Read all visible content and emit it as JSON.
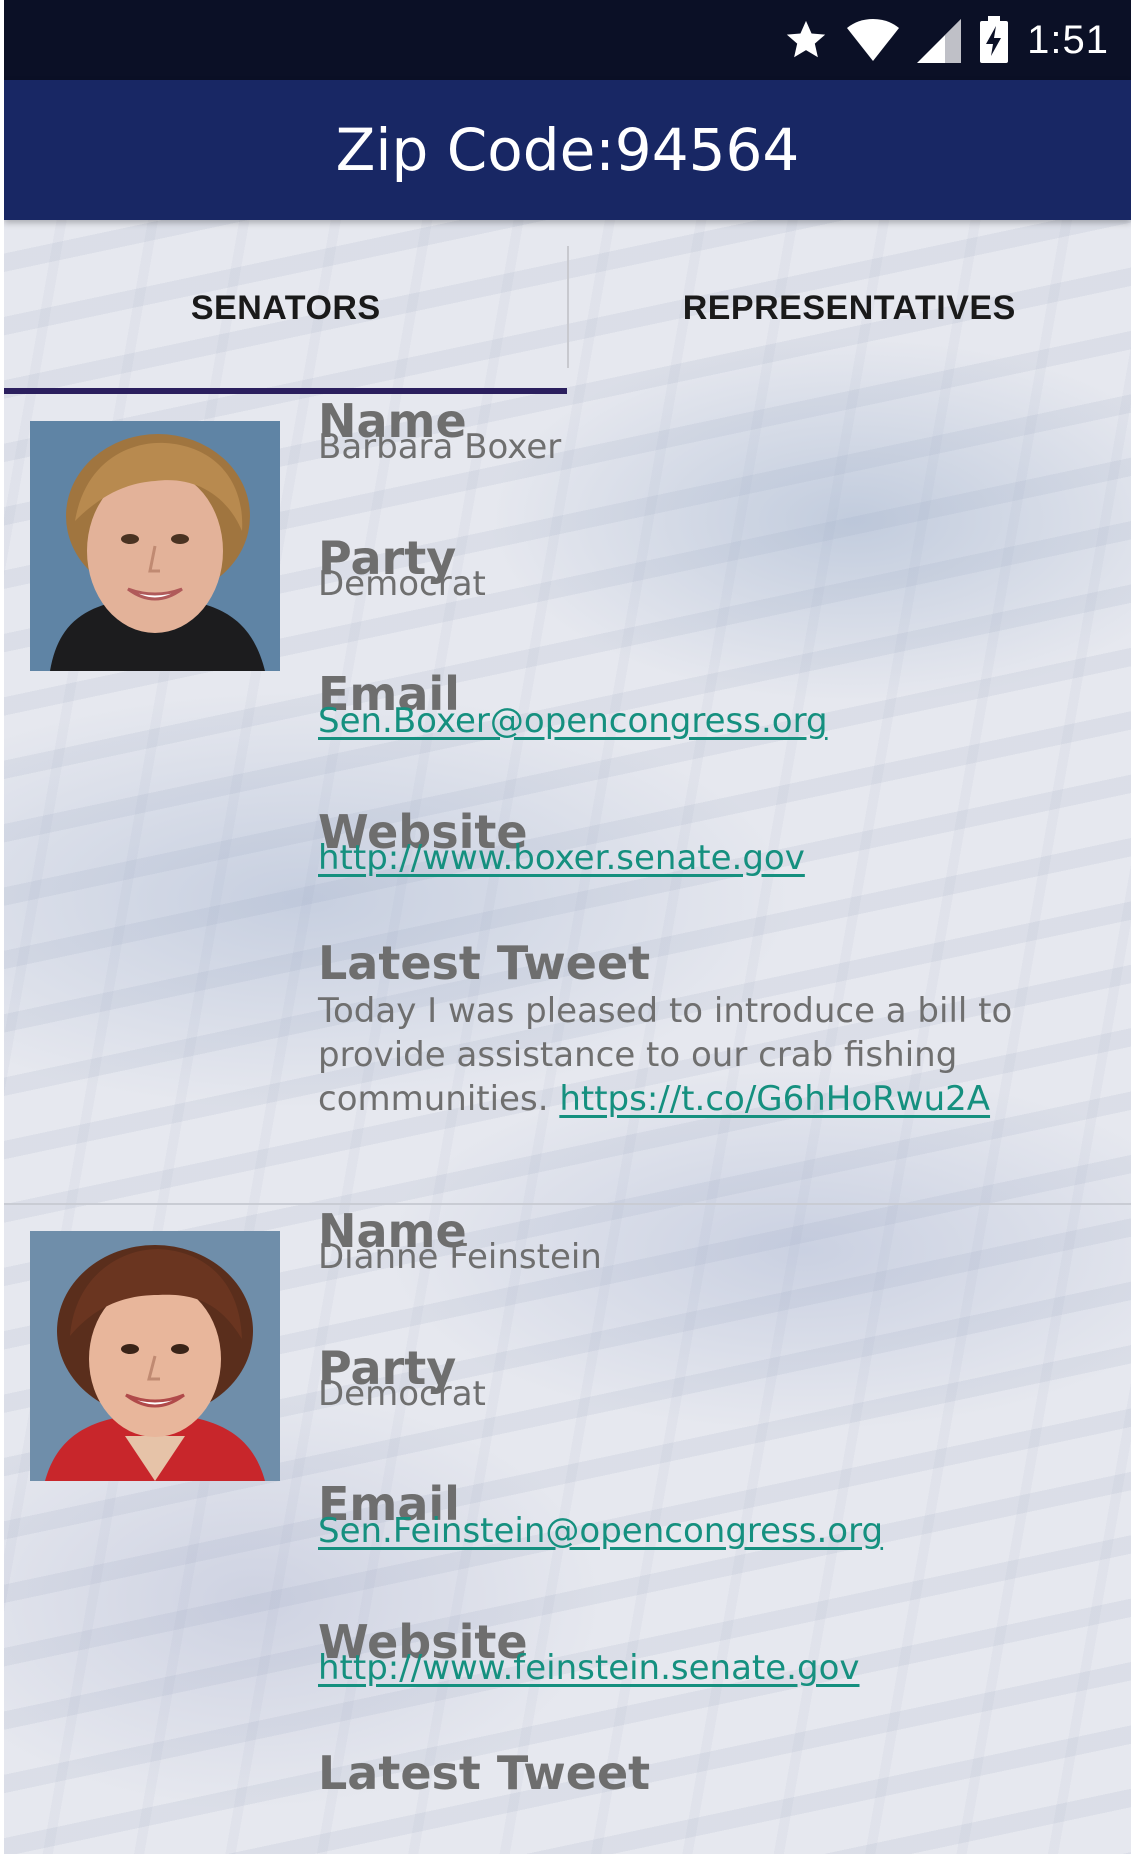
{
  "status_bar": {
    "time": "1:51",
    "icons": [
      "star-icon",
      "wifi-icon",
      "cell-signal-icon",
      "battery-charging-icon"
    ]
  },
  "app_bar": {
    "title": "Zip Code:94564",
    "background": "#182764"
  },
  "tabs": [
    {
      "label": "SENATORS",
      "selected": true
    },
    {
      "label": "REPRESENTATIVES",
      "selected": false
    }
  ],
  "colors": {
    "link": "#15907f",
    "tab_indicator": "#2b1f5e",
    "status_bar": "#0b1026"
  },
  "senators": [
    {
      "name_label": "Name",
      "name": "Barbara Boxer",
      "party_label": "Party",
      "party": "Democrat",
      "email_label": "Email",
      "email": "Sen.Boxer@opencongress.org",
      "website_label": "Website",
      "website": "http://www.boxer.senate.gov",
      "tweet_label": "Latest Tweet",
      "tweet_text": "Today I was pleased to introduce a bill to provide assistance to our crab fishing communities. ",
      "tweet_link": "https://t.co/G6hHoRwu2A"
    },
    {
      "name_label": "Name",
      "name": "Dianne Feinstein",
      "party_label": "Party",
      "party": "Democrat",
      "email_label": "Email",
      "email": "Sen.Feinstein@opencongress.org",
      "website_label": "Website",
      "website": "http://www.feinstein.senate.gov",
      "tweet_label": "Latest Tweet"
    }
  ]
}
